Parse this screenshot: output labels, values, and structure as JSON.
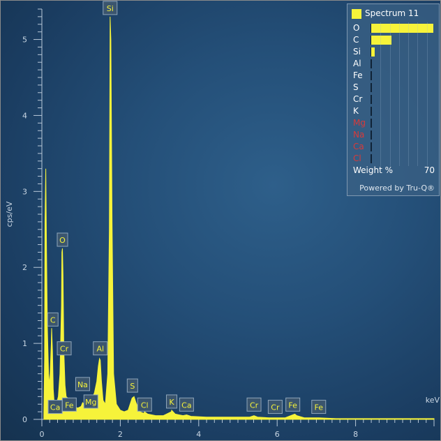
{
  "chart_data": {
    "type": "line",
    "ylabel": "cps/eV",
    "xunit": "keV",
    "xlim": [
      0,
      10
    ],
    "ylim": [
      0,
      5.4
    ],
    "xticks": [
      0,
      2,
      4,
      6,
      8
    ],
    "yticks": [
      0,
      1,
      2,
      3,
      4,
      5
    ],
    "series": [
      {
        "name": "Spectrum 11",
        "color": "#f6f33a",
        "x": [
          0.05,
          0.07,
          0.08,
          0.1,
          0.12,
          0.14,
          0.17,
          0.2,
          0.24,
          0.25,
          0.27,
          0.29,
          0.31,
          0.34,
          0.38,
          0.42,
          0.46,
          0.5,
          0.51,
          0.525,
          0.54,
          0.56,
          0.59,
          0.62,
          0.66,
          0.7,
          0.74,
          0.79,
          0.85,
          0.92,
          1.0,
          1.04,
          1.08,
          1.12,
          1.16,
          1.2,
          1.25,
          1.3,
          1.34,
          1.4,
          1.44,
          1.47,
          1.49,
          1.52,
          1.56,
          1.62,
          1.68,
          1.72,
          1.74,
          1.76,
          1.79,
          1.83,
          1.9,
          2.0,
          2.1,
          2.2,
          2.3,
          2.35,
          2.4,
          2.5,
          2.6,
          2.62,
          2.7,
          2.9,
          3.1,
          3.3,
          3.31,
          3.4,
          3.6,
          3.69,
          3.8,
          4.2,
          4.8,
          5.3,
          5.41,
          5.5,
          5.8,
          5.95,
          6.2,
          6.4,
          6.45,
          6.5,
          6.7,
          7.06,
          7.5,
          8.0,
          9.0,
          10.0
        ],
        "y": [
          0.05,
          0.8,
          2.6,
          3.3,
          2.2,
          1.2,
          0.6,
          0.45,
          1.0,
          1.2,
          0.9,
          0.4,
          0.25,
          0.2,
          0.22,
          0.3,
          0.6,
          1.5,
          2.2,
          2.25,
          1.9,
          0.9,
          0.45,
          0.3,
          0.28,
          0.25,
          0.2,
          0.18,
          0.16,
          0.15,
          0.17,
          0.22,
          0.2,
          0.18,
          0.2,
          0.22,
          0.25,
          0.3,
          0.35,
          0.5,
          0.7,
          0.8,
          0.78,
          0.5,
          0.25,
          0.2,
          0.6,
          2.5,
          5.3,
          5.0,
          2.6,
          0.6,
          0.2,
          0.12,
          0.1,
          0.12,
          0.28,
          0.3,
          0.22,
          0.1,
          0.08,
          0.1,
          0.07,
          0.05,
          0.05,
          0.1,
          0.12,
          0.07,
          0.05,
          0.06,
          0.04,
          0.03,
          0.03,
          0.03,
          0.05,
          0.03,
          0.02,
          0.02,
          0.02,
          0.06,
          0.07,
          0.05,
          0.02,
          0.02,
          0.01,
          0.01,
          0.01,
          0.01
        ]
      }
    ],
    "peak_labels": [
      {
        "text": "Si",
        "x": 1.74,
        "y": 5.3
      },
      {
        "text": "O",
        "x": 0.525,
        "y": 2.25
      },
      {
        "text": "C",
        "x": 0.28,
        "y": 1.2
      },
      {
        "text": "Cr",
        "x": 0.57,
        "y": 0.82
      },
      {
        "text": "Al",
        "x": 1.49,
        "y": 0.82
      },
      {
        "text": "Na",
        "x": 1.04,
        "y": 0.35
      },
      {
        "text": "Mg",
        "x": 1.25,
        "y": 0.12
      },
      {
        "text": "Ca",
        "x": 0.34,
        "y": 0.05
      },
      {
        "text": "Fe",
        "x": 0.7,
        "y": 0.08
      },
      {
        "text": "S",
        "x": 2.31,
        "y": 0.33
      },
      {
        "text": "Cl",
        "x": 2.62,
        "y": 0.08
      },
      {
        "text": "K",
        "x": 3.31,
        "y": 0.12
      },
      {
        "text": "Ca",
        "x": 3.69,
        "y": 0.08
      },
      {
        "text": "Cr",
        "x": 5.41,
        "y": 0.08
      },
      {
        "text": "Cr",
        "x": 5.95,
        "y": 0.05
      },
      {
        "text": "Fe",
        "x": 6.4,
        "y": 0.08
      },
      {
        "text": "Fe",
        "x": 7.06,
        "y": 0.05
      }
    ],
    "legend": {
      "title": "Spectrum 11",
      "placement": "top-right",
      "axis_label": "Weight %",
      "axis_max": "70",
      "powered_by": "Powered by Tru-Q®",
      "rows": [
        {
          "label": "O",
          "value": 67,
          "red": false
        },
        {
          "label": "C",
          "value": 22,
          "red": false
        },
        {
          "label": "Si",
          "value": 3.5,
          "red": false
        },
        {
          "label": "Al",
          "value": 0,
          "red": false
        },
        {
          "label": "Fe",
          "value": 0,
          "red": false
        },
        {
          "label": "S",
          "value": 0,
          "red": false
        },
        {
          "label": "Cr",
          "value": 0,
          "red": false
        },
        {
          "label": "K",
          "value": 0,
          "red": false
        },
        {
          "label": "Mg",
          "value": 0,
          "red": true
        },
        {
          "label": "Na",
          "value": 0,
          "red": true
        },
        {
          "label": "Ca",
          "value": 0,
          "red": true
        },
        {
          "label": "Cl",
          "value": 0,
          "red": true
        }
      ]
    }
  }
}
